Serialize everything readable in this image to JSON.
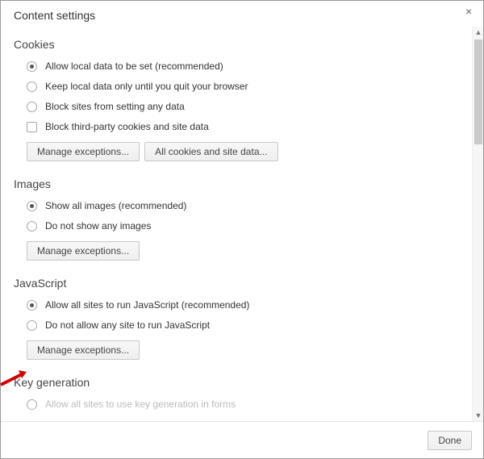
{
  "dialog": {
    "title": "Content settings",
    "close_label": "×",
    "done_label": "Done"
  },
  "sections": {
    "cookies": {
      "title": "Cookies",
      "opt_allow": "Allow local data to be set (recommended)",
      "opt_session": "Keep local data only until you quit your browser",
      "opt_block": "Block sites from setting any data",
      "opt_block_thirdparty": "Block third-party cookies and site data",
      "btn_manage": "Manage exceptions...",
      "btn_all_cookies": "All cookies and site data..."
    },
    "images": {
      "title": "Images",
      "opt_show": "Show all images (recommended)",
      "opt_block": "Do not show any images",
      "btn_manage": "Manage exceptions..."
    },
    "javascript": {
      "title": "JavaScript",
      "opt_allow": "Allow all sites to run JavaScript (recommended)",
      "opt_block": "Do not allow any site to run JavaScript",
      "btn_manage": "Manage exceptions..."
    },
    "keygen": {
      "title": "Key generation",
      "opt_allow": "Allow all sites to use key generation in forms"
    }
  }
}
